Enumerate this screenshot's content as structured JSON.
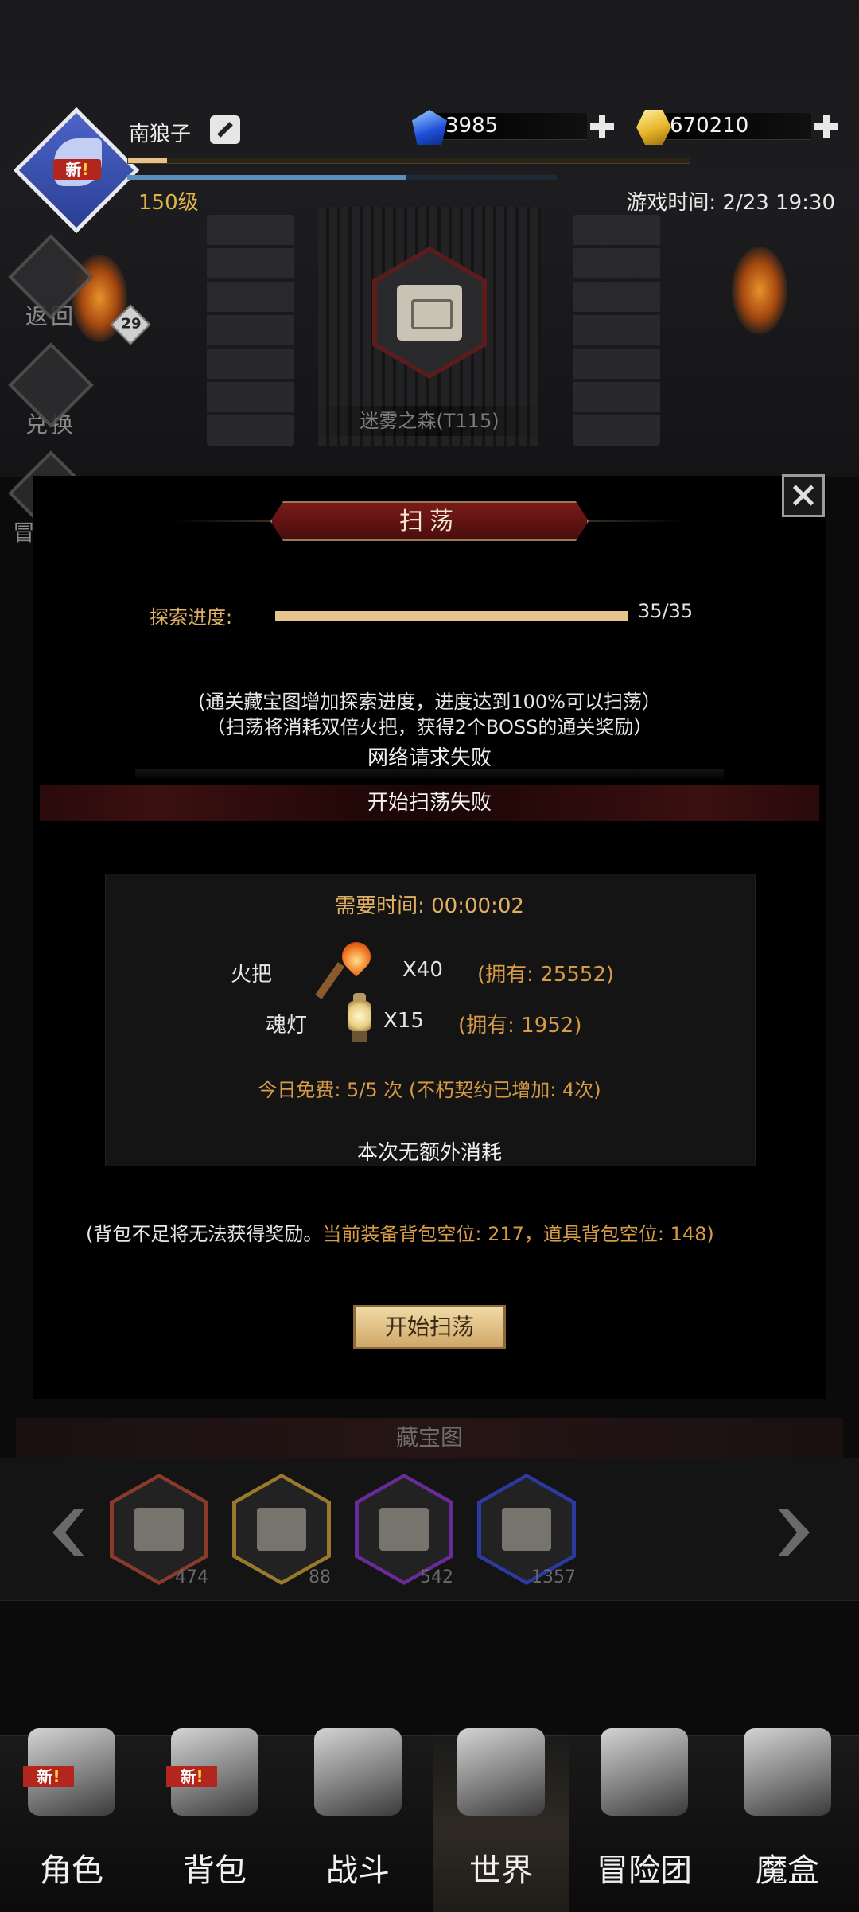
{
  "player": {
    "name": "南狼子",
    "level_text": "150级",
    "small_level": "29",
    "new_tag": "新",
    "new_tag_bang": "!",
    "xp_fraction": 0.07,
    "hp_fraction": 0.65
  },
  "currency": {
    "gems": "3985",
    "gold": "670210"
  },
  "game_time": "游戏时间: 2/23 19:30",
  "side_buttons": [
    {
      "label": "返回"
    },
    {
      "label": "兑换"
    },
    {
      "label": "冒险者"
    }
  ],
  "stage": {
    "name": "迷雾之森(T115)"
  },
  "modal": {
    "title": "扫荡",
    "progress_label": "探索进度:",
    "progress_count": "35/35",
    "progress_fraction": 1.0,
    "note1": "(通关藏宝图增加探索进度，进度达到100%可以扫荡）",
    "note2": "（扫荡将消耗双倍火把，获得2个BOSS的通关奖励）",
    "network_fail": "网络请求失败",
    "start_fail": "开始扫荡失败",
    "need_time_label": "需要时间:",
    "need_time_value": "00:00:02",
    "costs": [
      {
        "name": "火把",
        "qty": "X40",
        "own": "(拥有: 25552)",
        "icon": "torch-icon"
      },
      {
        "name": "魂灯",
        "qty": "X15",
        "own": "(拥有: 1952)",
        "icon": "lamp-icon"
      }
    ],
    "free_today": "今日免费: 5/5 次 (不朽契约已增加: 4次)",
    "no_extra": "本次无额外消耗",
    "bag_note_prefix": "(背包不足将无法获得奖励。",
    "bag_note_hl": "当前装备背包空位: 217，道具背包空位: 148",
    "bag_note_suffix": ")",
    "start_button": "开始扫荡"
  },
  "treasure": {
    "header": "藏宝图",
    "maps": [
      {
        "count": "474",
        "color": "#8a3a2a"
      },
      {
        "count": "88",
        "color": "#9a7a2a"
      },
      {
        "count": "542",
        "color": "#6a2a9a"
      },
      {
        "count": "1357",
        "color": "#2a3aa0"
      }
    ]
  },
  "nav": [
    {
      "label": "角色",
      "icon": "helmet-icon",
      "new": true
    },
    {
      "label": "背包",
      "icon": "backpack-icon",
      "new": true
    },
    {
      "label": "战斗",
      "icon": "shield-sword-icon",
      "new": false
    },
    {
      "label": "世界",
      "icon": "world-map-icon",
      "new": false,
      "active": true
    },
    {
      "label": "冒险团",
      "icon": "castle-icon",
      "new": false
    },
    {
      "label": "魔盒",
      "icon": "magic-box-icon",
      "new": false
    }
  ],
  "colors": {
    "accent_gold": "#e0b064",
    "modal_bg": "#000000",
    "banner_red": "#7a1a1a"
  }
}
